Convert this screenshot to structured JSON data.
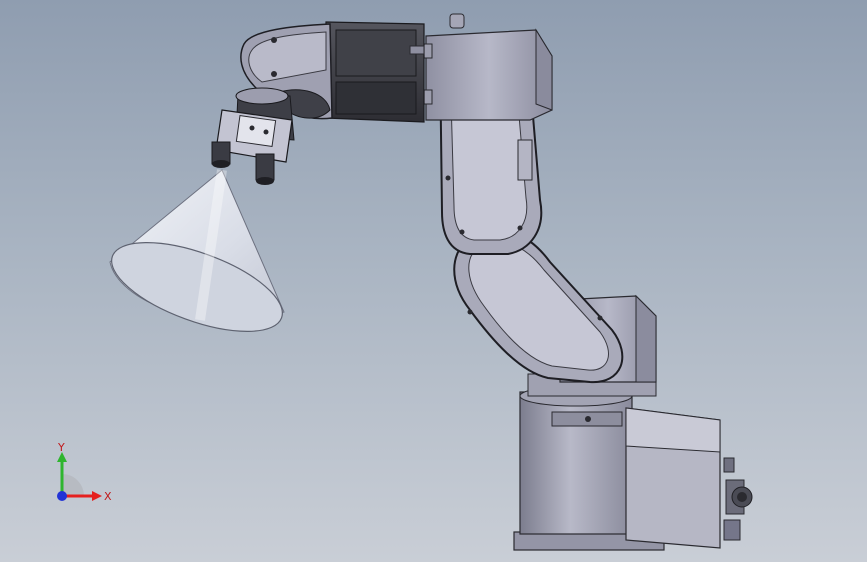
{
  "viewport": {
    "background_top": "#8f9db0",
    "background_bottom": "#c9ced6"
  },
  "triad": {
    "x_label": "X",
    "y_label": "Y",
    "x_color": "#e5201f",
    "y_color": "#2fb52f",
    "z_color": "#2233d6"
  },
  "colors": {
    "robot_body": "#a7a8b8",
    "robot_dark": "#3a3a40",
    "robot_cover": "#c4c5d4",
    "light_cone": "#e3e6ef"
  }
}
